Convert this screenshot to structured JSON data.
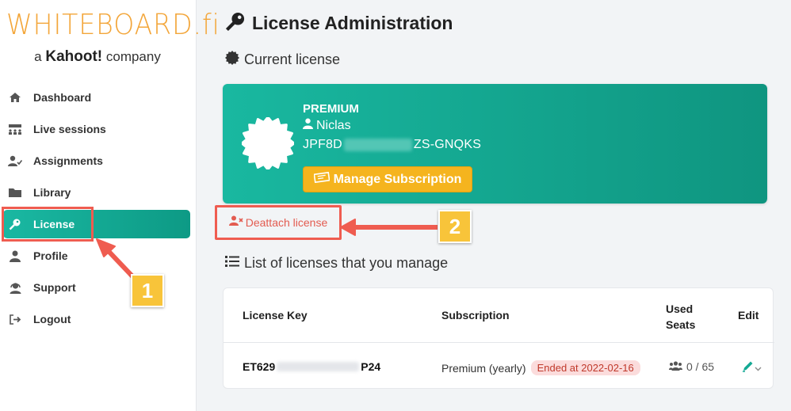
{
  "brand": {
    "wordmark": "WHITEBOARD.fi",
    "tagline_pre": "a",
    "tagline_brand": "Kahoot!",
    "tagline_post": "company"
  },
  "sidebar": {
    "items": [
      {
        "label": "Dashboard",
        "icon": "home-icon"
      },
      {
        "label": "Live sessions",
        "icon": "live-sessions-icon"
      },
      {
        "label": "Assignments",
        "icon": "assignments-icon"
      },
      {
        "label": "Library",
        "icon": "folder-icon"
      },
      {
        "label": "License",
        "icon": "key-icon",
        "active": true
      },
      {
        "label": "Profile",
        "icon": "user-icon"
      },
      {
        "label": "Support",
        "icon": "support-icon"
      },
      {
        "label": "Logout",
        "icon": "logout-icon"
      }
    ]
  },
  "page": {
    "title": "License Administration",
    "current_license_heading": "Current license",
    "list_heading": "List of licenses that you manage"
  },
  "license_card": {
    "tier": "PREMIUM",
    "user": "Niclas",
    "key_prefix": "JPF8D",
    "key_suffix": "ZS-GNQKS",
    "manage_button": "Manage Subscription"
  },
  "deattach": {
    "label": "Deattach license"
  },
  "table": {
    "headers": {
      "key": "License Key",
      "subscription": "Subscription",
      "used_seats_line1": "Used",
      "used_seats_line2": "Seats",
      "edit": "Edit"
    },
    "rows": [
      {
        "key_prefix": "ET629",
        "key_suffix": "P24",
        "subscription": "Premium (yearly)",
        "status": "Ended at 2022-02-16",
        "seats": "0 / 65"
      }
    ]
  },
  "annotations": {
    "callout_1": "1",
    "callout_2": "2"
  },
  "colors": {
    "accent": "#13a994",
    "brand_orange": "#f3a63a",
    "button_yellow": "#f5b41e",
    "danger": "#e35b50",
    "callout_yellow": "#f8c43a"
  }
}
